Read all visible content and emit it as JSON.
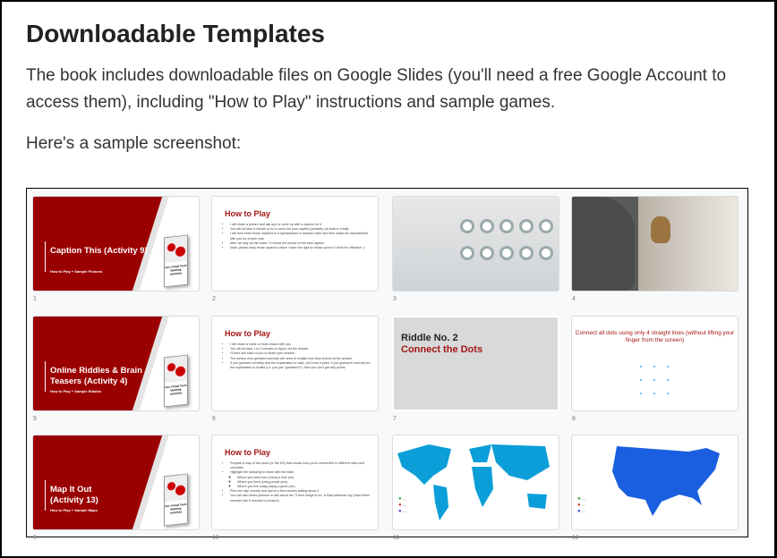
{
  "heading": "Downloadable Templates",
  "intro": "The book includes downloadable files on Google Slides (you'll need a free Google Account to access them), including \"How to Play\" instructions and sample games.",
  "sample_label": "Here's a sample screenshot:",
  "colors": {
    "brand_red": "#9b0000",
    "accent_red": "#a31515",
    "map_blue": "#0b9ed8"
  },
  "book_title": "Fun Virtual Team Building Activities",
  "slides": [
    {
      "num": "1",
      "title": "Caption This (Activity 9)",
      "subtitle": "How to Play + Sample Pictures"
    },
    {
      "num": "2",
      "title": "How to Play",
      "bullets": [
        "I will share a picture and ask you to come up with a caption for it",
        "You will all have a minute or so to send me your caption (privately via chat or email)",
        "I will then enter those captions in a spreadsheet in random order and then share the spreadsheet with you for a team vote",
        "After we tally up the votes, I'll reveal the winner of the best caption",
        "Note: please keep those captions clean! I have the right to refuse yours if I think it's offensive :)"
      ]
    },
    {
      "num": "3",
      "image": "laundromat-photo"
    },
    {
      "num": "4",
      "image": "dog-on-chair-photo"
    },
    {
      "num": "5",
      "title": "Online Riddles & Brain Teasers (Activity 4)",
      "subtitle": "How to Play + Sample Riddles"
    },
    {
      "num": "6",
      "title": "How to Play",
      "bullets": [
        "I will share a riddle or brain teaser with you",
        "You will all have 1 to 2 minutes to figure out the answer",
        "I'll then ask each of you to share your answer",
        "The person who guessed correctly will need to explain how they arrived at the answer",
        "If you guessed correctly and the explanation is valid, you'll win a point. If you guessed correctly but the explanation is invalid (i.e. you just \"guessed it\"), then you don't get any points."
      ]
    },
    {
      "num": "7",
      "line1": "Riddle No. 2",
      "line2": "Connect the Dots"
    },
    {
      "num": "8",
      "question": "Connect all dots using only 4 straight lines (without lifting your finger from the screen)"
    },
    {
      "num": "9",
      "title": "Map It Out (Activity 13)",
      "subtitle": "How to Play + Sample Maps"
    },
    {
      "num": "10",
      "title": "How to Play",
      "bullets": [
        "Prepare a map of the world (or the US) that shows how you're connected to different cities and countries",
        "Highlight the following to share with the team",
        "Pick one city/ country and spend a few minutes talking about it",
        "You can also share pictures or talk about the \"3 best things to do\" in that particular city (each team member has 5 minutes to present)"
      ],
      "sub_bullets": [
        "Where you were born (using a blue pin)",
        "Where you lived (using purple pins)",
        "Where you live today (using a green pin)"
      ]
    },
    {
      "num": "11",
      "image": "world-map"
    },
    {
      "num": "12",
      "image": "us-map"
    }
  ]
}
